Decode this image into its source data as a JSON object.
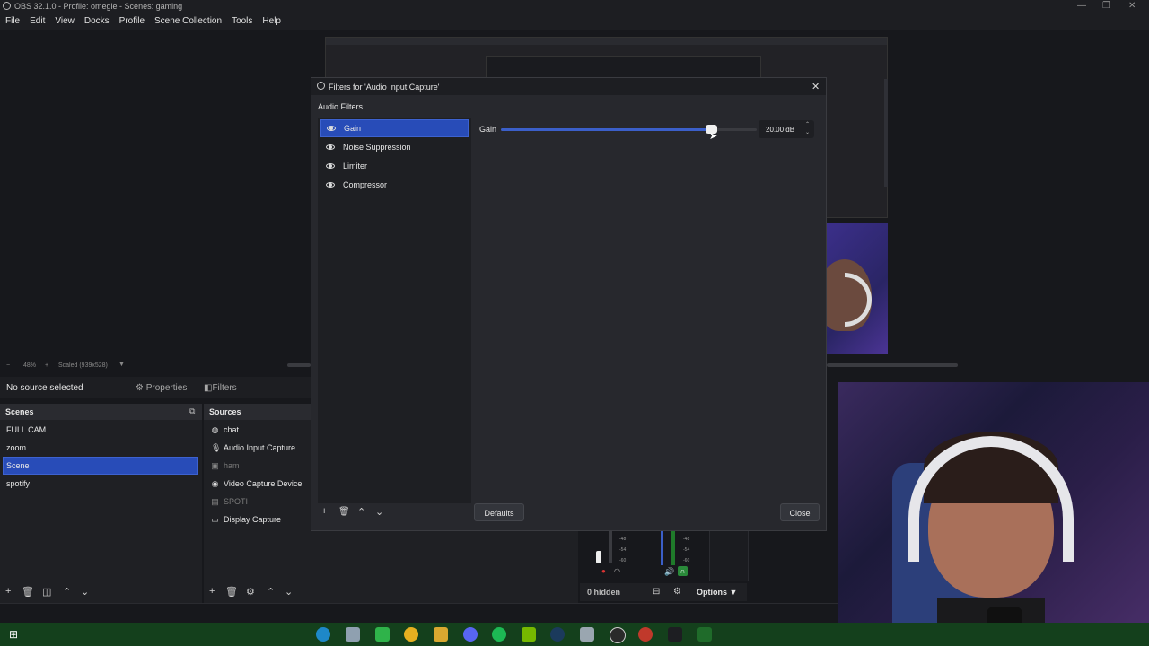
{
  "window": {
    "title": "OBS 32.1.0 - Profile: omegle - Scenes: gaming"
  },
  "menu": [
    "File",
    "Edit",
    "View",
    "Docks",
    "Profile",
    "Scene Collection",
    "Tools",
    "Help"
  ],
  "preview": {
    "zoom": "48%",
    "scale": "Scaled (939x528)"
  },
  "source_bar": {
    "status": "No source selected",
    "properties": "Properties",
    "filters": "Filters"
  },
  "scenes": {
    "header": "Scenes",
    "items": [
      "FULL CAM",
      "zoom",
      "Scene",
      "spotify"
    ],
    "selected": "Scene"
  },
  "sources": {
    "header": "Sources",
    "items": [
      {
        "label": "chat",
        "icon": "globe-icon",
        "dim": false
      },
      {
        "label": "Audio Input Capture",
        "icon": "microphone-icon",
        "dim": false
      },
      {
        "label": "ham",
        "icon": "image-icon",
        "dim": true
      },
      {
        "label": "Video Capture Device",
        "icon": "camera-icon",
        "dim": false
      },
      {
        "label": "SPOTI",
        "icon": "window-icon",
        "dim": true
      },
      {
        "label": "Display Capture",
        "icon": "monitor-icon",
        "dim": false
      }
    ]
  },
  "dialog": {
    "title": "Filters for 'Audio Input Capture'",
    "section_label": "Audio Filters",
    "filters": [
      "Gain",
      "Noise Suppression",
      "Limiter",
      "Compressor"
    ],
    "selected_filter": "Gain",
    "gain": {
      "label": "Gain",
      "value_text": "20.00 dB",
      "level_fraction": 0.82
    },
    "defaults_button": "Defaults",
    "close_button": "Close"
  },
  "mixer": {
    "ticks_left": [
      "-48",
      "-54",
      "-60"
    ],
    "ticks_right": [
      "-48",
      "-54",
      "-60"
    ],
    "hidden": "0 hidden",
    "options": "Options"
  },
  "colors": {
    "accent": "#284cb8",
    "bg": "#17181c",
    "taskbar": "#14401c"
  }
}
